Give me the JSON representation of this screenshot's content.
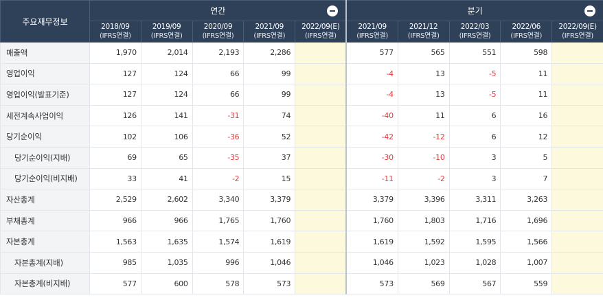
{
  "header": {
    "corner_label": "주요재무정보",
    "annual_label": "연간",
    "quarter_label": "분기",
    "annual_periods": [
      {
        "period": "2018/09",
        "basis": "(IFRS연결)"
      },
      {
        "period": "2019/09",
        "basis": "(IFRS연결)"
      },
      {
        "period": "2020/09",
        "basis": "(IFRS연결)"
      },
      {
        "period": "2021/09",
        "basis": "(IFRS연결)"
      },
      {
        "period": "2022/09(E)",
        "basis": "(IFRS연결)"
      }
    ],
    "quarter_periods": [
      {
        "period": "2021/09",
        "basis": "(IFRS연결)"
      },
      {
        "period": "2021/12",
        "basis": "(IFRS연결)"
      },
      {
        "period": "2022/03",
        "basis": "(IFRS연결)"
      },
      {
        "period": "2022/06",
        "basis": "(IFRS연결)"
      },
      {
        "period": "2022/09(E)",
        "basis": "(IFRS연결)"
      }
    ]
  },
  "colors": {
    "header_bg": "#2f4159",
    "negative": "#e03b3b",
    "estimate_bg": "#fdf9dc",
    "label_bg": "#f3f4f6"
  },
  "rows": [
    {
      "label": "매출액",
      "indent": false,
      "annual": [
        "1,970",
        "2,014",
        "2,193",
        "2,286",
        ""
      ],
      "quarter": [
        "577",
        "565",
        "551",
        "598",
        ""
      ]
    },
    {
      "label": "영업이익",
      "indent": false,
      "annual": [
        "127",
        "124",
        "66",
        "99",
        ""
      ],
      "quarter": [
        "-4",
        "13",
        "-5",
        "11",
        ""
      ]
    },
    {
      "label": "영업이익(발표기준)",
      "indent": false,
      "annual": [
        "127",
        "124",
        "66",
        "99",
        ""
      ],
      "quarter": [
        "-4",
        "13",
        "-5",
        "11",
        ""
      ]
    },
    {
      "label": "세전계속사업이익",
      "indent": false,
      "annual": [
        "126",
        "141",
        "-31",
        "74",
        ""
      ],
      "quarter": [
        "-40",
        "11",
        "6",
        "16",
        ""
      ]
    },
    {
      "label": "당기순이익",
      "indent": false,
      "annual": [
        "102",
        "106",
        "-36",
        "52",
        ""
      ],
      "quarter": [
        "-42",
        "-12",
        "6",
        "12",
        ""
      ]
    },
    {
      "label": "당기순이익(지배)",
      "indent": true,
      "annual": [
        "69",
        "65",
        "-35",
        "37",
        ""
      ],
      "quarter": [
        "-30",
        "-10",
        "3",
        "5",
        ""
      ]
    },
    {
      "label": "당기순이익(비지배)",
      "indent": true,
      "annual": [
        "33",
        "41",
        "-2",
        "15",
        ""
      ],
      "quarter": [
        "-11",
        "-2",
        "3",
        "7",
        ""
      ]
    },
    {
      "label": "자산총계",
      "indent": false,
      "annual": [
        "2,529",
        "2,602",
        "3,340",
        "3,379",
        ""
      ],
      "quarter": [
        "3,379",
        "3,396",
        "3,311",
        "3,263",
        ""
      ]
    },
    {
      "label": "부채총계",
      "indent": false,
      "annual": [
        "966",
        "966",
        "1,765",
        "1,760",
        ""
      ],
      "quarter": [
        "1,760",
        "1,803",
        "1,716",
        "1,696",
        ""
      ]
    },
    {
      "label": "자본총계",
      "indent": false,
      "annual": [
        "1,563",
        "1,635",
        "1,574",
        "1,619",
        ""
      ],
      "quarter": [
        "1,619",
        "1,592",
        "1,595",
        "1,566",
        ""
      ]
    },
    {
      "label": "자본총계(지배)",
      "indent": true,
      "annual": [
        "985",
        "1,035",
        "996",
        "1,046",
        ""
      ],
      "quarter": [
        "1,046",
        "1,023",
        "1,028",
        "1,007",
        ""
      ]
    },
    {
      "label": "자본총계(비지배)",
      "indent": true,
      "annual": [
        "577",
        "600",
        "578",
        "573",
        ""
      ],
      "quarter": [
        "573",
        "569",
        "567",
        "559",
        ""
      ]
    }
  ]
}
